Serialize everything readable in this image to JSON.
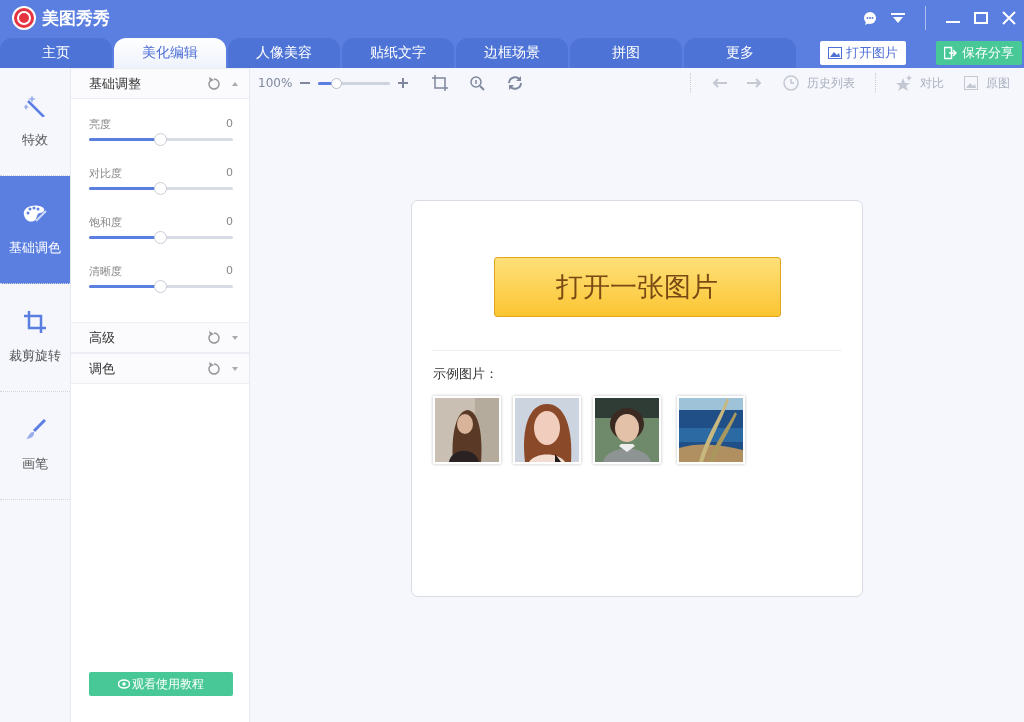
{
  "app": {
    "title": "美图秀秀"
  },
  "tabs": [
    {
      "label": "主页",
      "selected": false
    },
    {
      "label": "美化编辑",
      "selected": true
    },
    {
      "label": "人像美容",
      "selected": false
    },
    {
      "label": "贴纸文字",
      "selected": false
    },
    {
      "label": "边框场景",
      "selected": false
    },
    {
      "label": "拼图",
      "selected": false
    },
    {
      "label": "更多",
      "selected": false
    }
  ],
  "header_buttons": [
    {
      "kind": "open",
      "label": "打开图片"
    },
    {
      "kind": "save",
      "label": "保存分享"
    }
  ],
  "side_nav": [
    {
      "kind": "effects",
      "label": "特效",
      "selected": false
    },
    {
      "kind": "adjust",
      "label": "基础调色",
      "selected": true
    },
    {
      "kind": "crop",
      "label": "裁剪旋转",
      "selected": false
    },
    {
      "kind": "brush",
      "label": "画笔",
      "selected": false
    }
  ],
  "panel": {
    "sections": [
      {
        "title": "基础调整",
        "expanded": true,
        "sliders": [
          {
            "label": "亮度",
            "reading": "0",
            "level": 0.5
          },
          {
            "label": "对比度",
            "reading": "0",
            "level": 0.5
          },
          {
            "label": "饱和度",
            "reading": "0",
            "level": 0.5
          },
          {
            "label": "清晰度",
            "reading": "0",
            "level": 0.5
          }
        ]
      },
      {
        "title": "高级",
        "expanded": false
      },
      {
        "title": "调色",
        "expanded": false
      }
    ],
    "tutorial_button": "观看使用教程"
  },
  "toolbar": {
    "zoom": {
      "reading": "100%",
      "level": 0.25
    },
    "tools": [
      {
        "kind": "undo",
        "disabled": true
      },
      {
        "kind": "redo",
        "disabled": true
      },
      {
        "kind": "history",
        "label": "历史列表",
        "disabled": true
      },
      {
        "kind": "compare",
        "label": "对比",
        "disabled": true
      },
      {
        "kind": "original",
        "label": "原图",
        "disabled": true
      }
    ]
  },
  "start_card": {
    "open_button": "打开一张图片",
    "samples_label": "示例图片："
  }
}
